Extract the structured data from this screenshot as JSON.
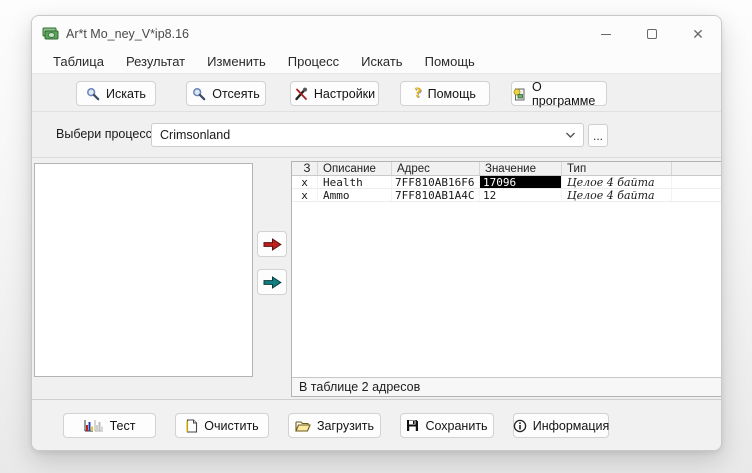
{
  "window": {
    "title": "Ar*t Mo_ney_V*ip8.16",
    "app_icon": "money-bills-icon",
    "controls": {
      "minimize": "minimize-icon",
      "maximize": "maximize-icon",
      "close": "close-icon"
    }
  },
  "menu": {
    "items": [
      "Таблица",
      "Результат",
      "Изменить",
      "Процесс",
      "Искать",
      "Помощь"
    ]
  },
  "toolbar": {
    "buttons": [
      {
        "label": "Искать",
        "icon": "search-icon"
      },
      {
        "label": "Отсеять",
        "icon": "filter-search-icon"
      },
      {
        "label": "Настройки",
        "icon": "tools-icon"
      },
      {
        "label": "Помощь",
        "icon": "question-icon",
        "glyph": "?"
      },
      {
        "label": "О программе",
        "icon": "about-icon"
      }
    ]
  },
  "process": {
    "label": "Выбери процесс",
    "selected": "Crimsonland",
    "browse_label": "...",
    "chevron": "chevron-down-icon"
  },
  "transfer": {
    "add_arrow": "red-arrow-right-icon",
    "add_all_arrow": "teal-arrow-right-icon"
  },
  "table": {
    "columns": [
      "З",
      "Описание",
      "Адрес",
      "Значение",
      "Тип"
    ],
    "rows": [
      {
        "freeze": "x",
        "description": "Health",
        "address": "7FF810AB16F6",
        "value": "17096",
        "type": "Целое 4 байта",
        "value_selected": true
      },
      {
        "freeze": "x",
        "description": "Ammo",
        "address": "7FF810AB1A4C",
        "value": "12",
        "type": "Целое 4 байта",
        "value_selected": false
      }
    ],
    "status": "В таблице 2 адресов"
  },
  "bottom": {
    "buttons": [
      {
        "label": "Тест",
        "icon": "bar-chart-icon"
      },
      {
        "label": "Очистить",
        "icon": "new-page-icon"
      },
      {
        "label": "Загрузить",
        "icon": "open-folder-icon"
      },
      {
        "label": "Сохранить",
        "icon": "floppy-disk-icon"
      },
      {
        "label": "Информация",
        "icon": "info-circle-icon"
      }
    ]
  },
  "colors": {
    "accent_red_arrow": "#c0201c",
    "accent_teal_arrow": "#0f7f7f",
    "selection_bg": "#000000",
    "selection_fg": "#ffffff",
    "window_bg": "#f0f0f0"
  }
}
